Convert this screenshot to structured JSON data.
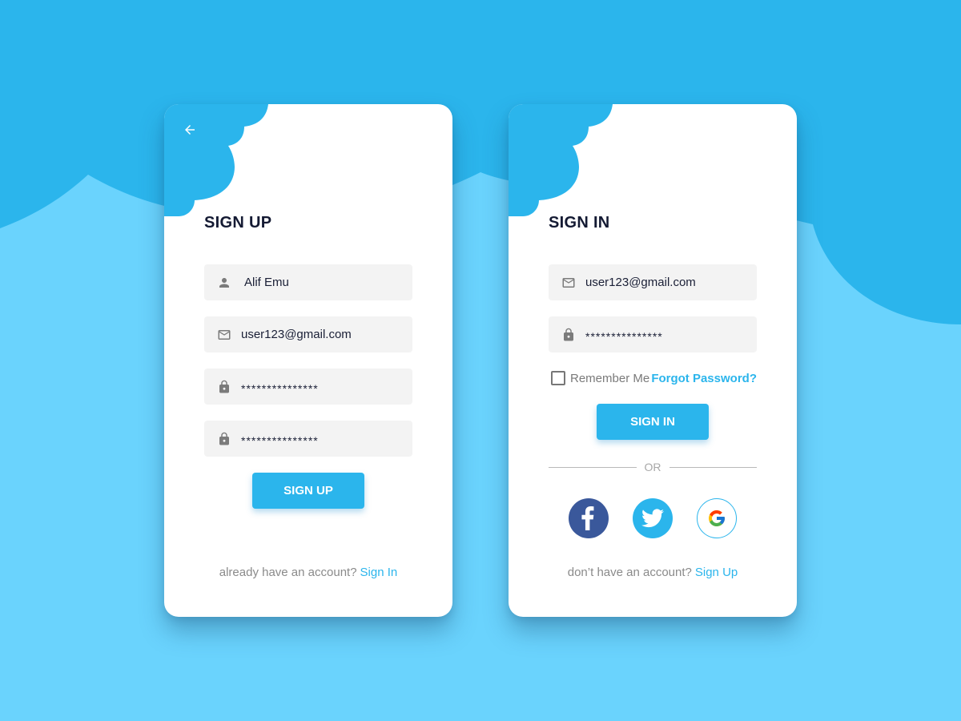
{
  "colors": {
    "background_light": "#6ad3fd",
    "background_dark": "#2bb5ec",
    "accent": "#2bb5ec",
    "facebook": "#3a589b",
    "twitter": "#2bb5ec",
    "title_text": "#141a33"
  },
  "signup": {
    "back_icon": "arrow-left-icon",
    "title": "SIGN UP",
    "fields": [
      {
        "icon": "person-icon",
        "value": "Alif Emu"
      },
      {
        "icon": "mail-icon",
        "value": "user123@gmail.com"
      },
      {
        "icon": "lock-icon",
        "value": "***************"
      },
      {
        "icon": "lock-icon",
        "value": "***************"
      }
    ],
    "button_label": "SIGN UP",
    "footer_text": "already have an account?",
    "footer_link": "Sign In"
  },
  "signin": {
    "title": "SIGN IN",
    "fields": [
      {
        "icon": "mail-icon",
        "value": "user123@gmail.com"
      },
      {
        "icon": "lock-icon",
        "value": "***************"
      }
    ],
    "remember_label": "Remember Me",
    "remember_checked": false,
    "forgot_label": "Forgot Password?",
    "button_label": "SIGN IN",
    "divider_label": "OR",
    "social": [
      {
        "icon": "facebook-icon"
      },
      {
        "icon": "twitter-icon"
      },
      {
        "icon": "google-icon"
      }
    ],
    "footer_text": "don’t have an account?",
    "footer_link": "Sign Up"
  }
}
